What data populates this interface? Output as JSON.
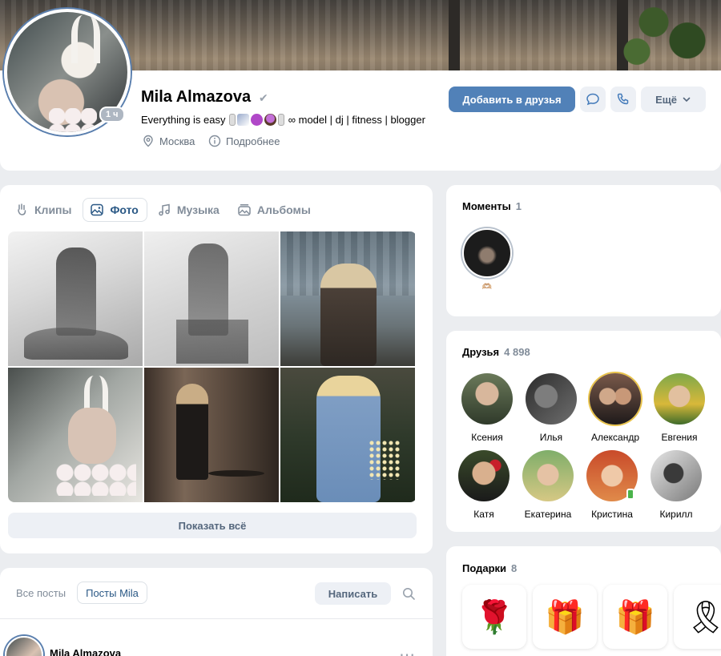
{
  "profile": {
    "name": "Mila Almazova",
    "verified_glyph": "✔",
    "status_prefix": "Everything is easy ",
    "status_suffix": " model | dj | fitness | blogger",
    "infinity": "∞",
    "city": "Москва",
    "details": "Подробнее",
    "online_badge": "1 ч"
  },
  "actions": {
    "add_friend": "Добавить в друзья",
    "more": "Ещё"
  },
  "media_tabs": [
    {
      "label": "Клипы",
      "icon": "clips-icon"
    },
    {
      "label": "Фото",
      "icon": "photo-icon"
    },
    {
      "label": "Музыка",
      "icon": "music-icon"
    },
    {
      "label": "Альбомы",
      "icon": "albums-icon"
    }
  ],
  "media": {
    "show_all": "Показать всё"
  },
  "moments": {
    "title": "Моменты",
    "count": "1",
    "item_label": "🫶🏼"
  },
  "friends": {
    "title": "Друзья",
    "count": "4 898",
    "list": [
      {
        "name": "Ксения"
      },
      {
        "name": "Илья"
      },
      {
        "name": "Александр"
      },
      {
        "name": "Евгения"
      },
      {
        "name": "Катя"
      },
      {
        "name": "Екатерина"
      },
      {
        "name": "Кристина"
      },
      {
        "name": "Кирилл"
      }
    ]
  },
  "gifts": {
    "title": "Подарки",
    "count": "8",
    "items": [
      "🌹",
      "🎁",
      "🎁",
      "🎗"
    ]
  },
  "posts": {
    "all_posts": "Все посты",
    "user_posts": "Посты Mila",
    "write": "Написать",
    "author": "Mila Almazova",
    "menu_glyph": "⋯"
  },
  "colors": {
    "accent": "#5181b8",
    "link": "#2a5885",
    "secondary_text": "#818c99",
    "page_bg": "#ebedf0"
  }
}
